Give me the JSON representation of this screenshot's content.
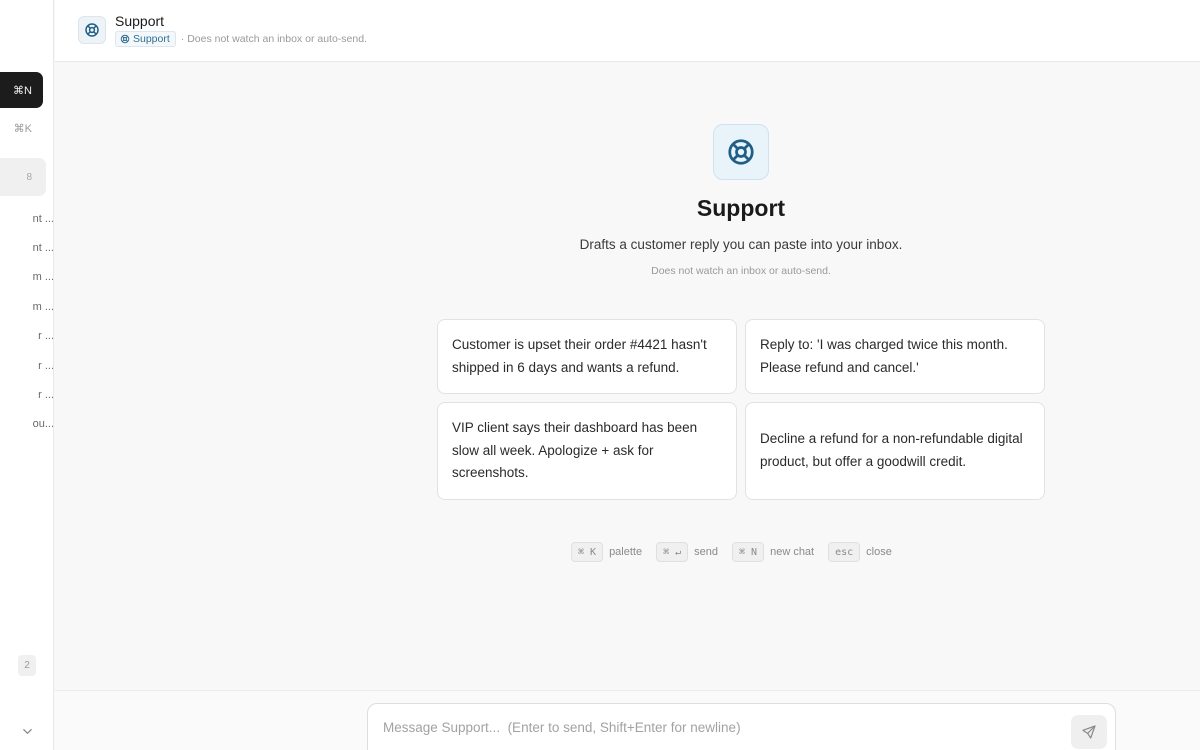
{
  "sidebar": {
    "new_chat_shortcut": "⌘N",
    "search_shortcut": "⌘K",
    "section_count": "8",
    "items": [
      "nt ...",
      "nt ...",
      "m ...",
      "m ...",
      "r ...",
      "r ...",
      "r ...",
      "ou..."
    ],
    "footer_count": "2"
  },
  "header": {
    "title": "Support",
    "chip_label": "Support",
    "subtitle": "· Does not watch an inbox or auto-send."
  },
  "hero": {
    "title": "Support",
    "description": "Drafts a customer reply you can paste into your inbox.",
    "note": "Does not watch an inbox or auto-send."
  },
  "suggestions": [
    "Customer is upset their order #4421 hasn't shipped in 6 days and wants a refund.",
    "Reply to: 'I was charged twice this month. Please refund and cancel.'",
    "VIP client says their dashboard has been slow all week. Apologize + ask for screenshots.",
    "Decline a refund for a non-refundable digital product, but offer a goodwill credit."
  ],
  "shortcuts": [
    {
      "keys": "⌘ K",
      "label": "palette"
    },
    {
      "keys": "⌘ ↵",
      "label": "send"
    },
    {
      "keys": "⌘ N",
      "label": "new chat"
    },
    {
      "keys": "esc",
      "label": "close"
    }
  ],
  "composer": {
    "placeholder": "Message Support...  (Enter to send, Shift+Enter for newline)",
    "value": ""
  },
  "icons": {
    "assistant": "lifebuoy-icon",
    "send": "send-icon",
    "expand": "chevron-down-icon"
  },
  "colors": {
    "accent": "#1f5f86",
    "dark_button": "#1c1c1c"
  }
}
